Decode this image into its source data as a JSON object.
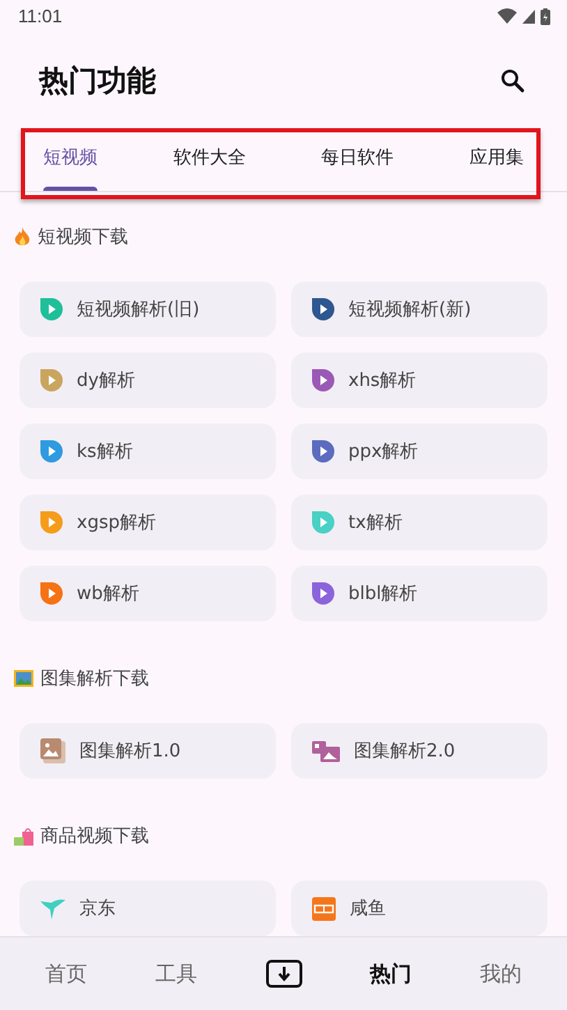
{
  "status_bar": {
    "time": "11:01"
  },
  "header": {
    "title": "热门功能"
  },
  "tabs": [
    {
      "label": "短视频",
      "selected": true
    },
    {
      "label": "软件大全",
      "selected": false
    },
    {
      "label": "每日软件",
      "selected": false
    },
    {
      "label": "应用集",
      "selected": false
    }
  ],
  "sections": [
    {
      "title": "短视频下载",
      "kind": "fire",
      "items": [
        {
          "label": "短视频解析(旧)",
          "kind": "play",
          "color": "#1fbf9a"
        },
        {
          "label": "短视频解析(新)",
          "kind": "play",
          "color": "#2d5790"
        },
        {
          "label": "dy解析",
          "kind": "play",
          "color": "#c9a55e"
        },
        {
          "label": "xhs解析",
          "kind": "play",
          "color": "#9b59b6"
        },
        {
          "label": "ks解析",
          "kind": "play",
          "color": "#2e9be0"
        },
        {
          "label": "ppx解析",
          "kind": "play",
          "color": "#5b6bbf"
        },
        {
          "label": "xgsp解析",
          "kind": "play",
          "color": "#f59c1a"
        },
        {
          "label": "tx解析",
          "kind": "play",
          "color": "#48d1c4"
        },
        {
          "label": "wb解析",
          "kind": "play",
          "color": "#f57215"
        },
        {
          "label": "blbl解析",
          "kind": "play",
          "color": "#8b64db"
        }
      ]
    },
    {
      "title": "图集解析下载",
      "kind": "picture",
      "items": [
        {
          "label": "图集解析1.0",
          "kind": "photo",
          "color": "#b98a70"
        },
        {
          "label": "图集解析2.0",
          "kind": "photos",
          "color": "#b0609a"
        }
      ]
    },
    {
      "title": "商品视频下载",
      "kind": "bag",
      "items": [
        {
          "label": "京东",
          "kind": "bird",
          "color": "#3fd0c0"
        },
        {
          "label": "咸鱼",
          "kind": "tile",
          "color": "#f5761a"
        }
      ]
    }
  ],
  "bottom_nav": [
    {
      "kind": "text",
      "label": "首页",
      "selected": false
    },
    {
      "kind": "text",
      "label": "工具",
      "selected": false
    },
    {
      "kind": "download",
      "selected": false
    },
    {
      "kind": "text",
      "label": "热门",
      "selected": true
    },
    {
      "kind": "text",
      "label": "我的",
      "selected": false
    }
  ]
}
